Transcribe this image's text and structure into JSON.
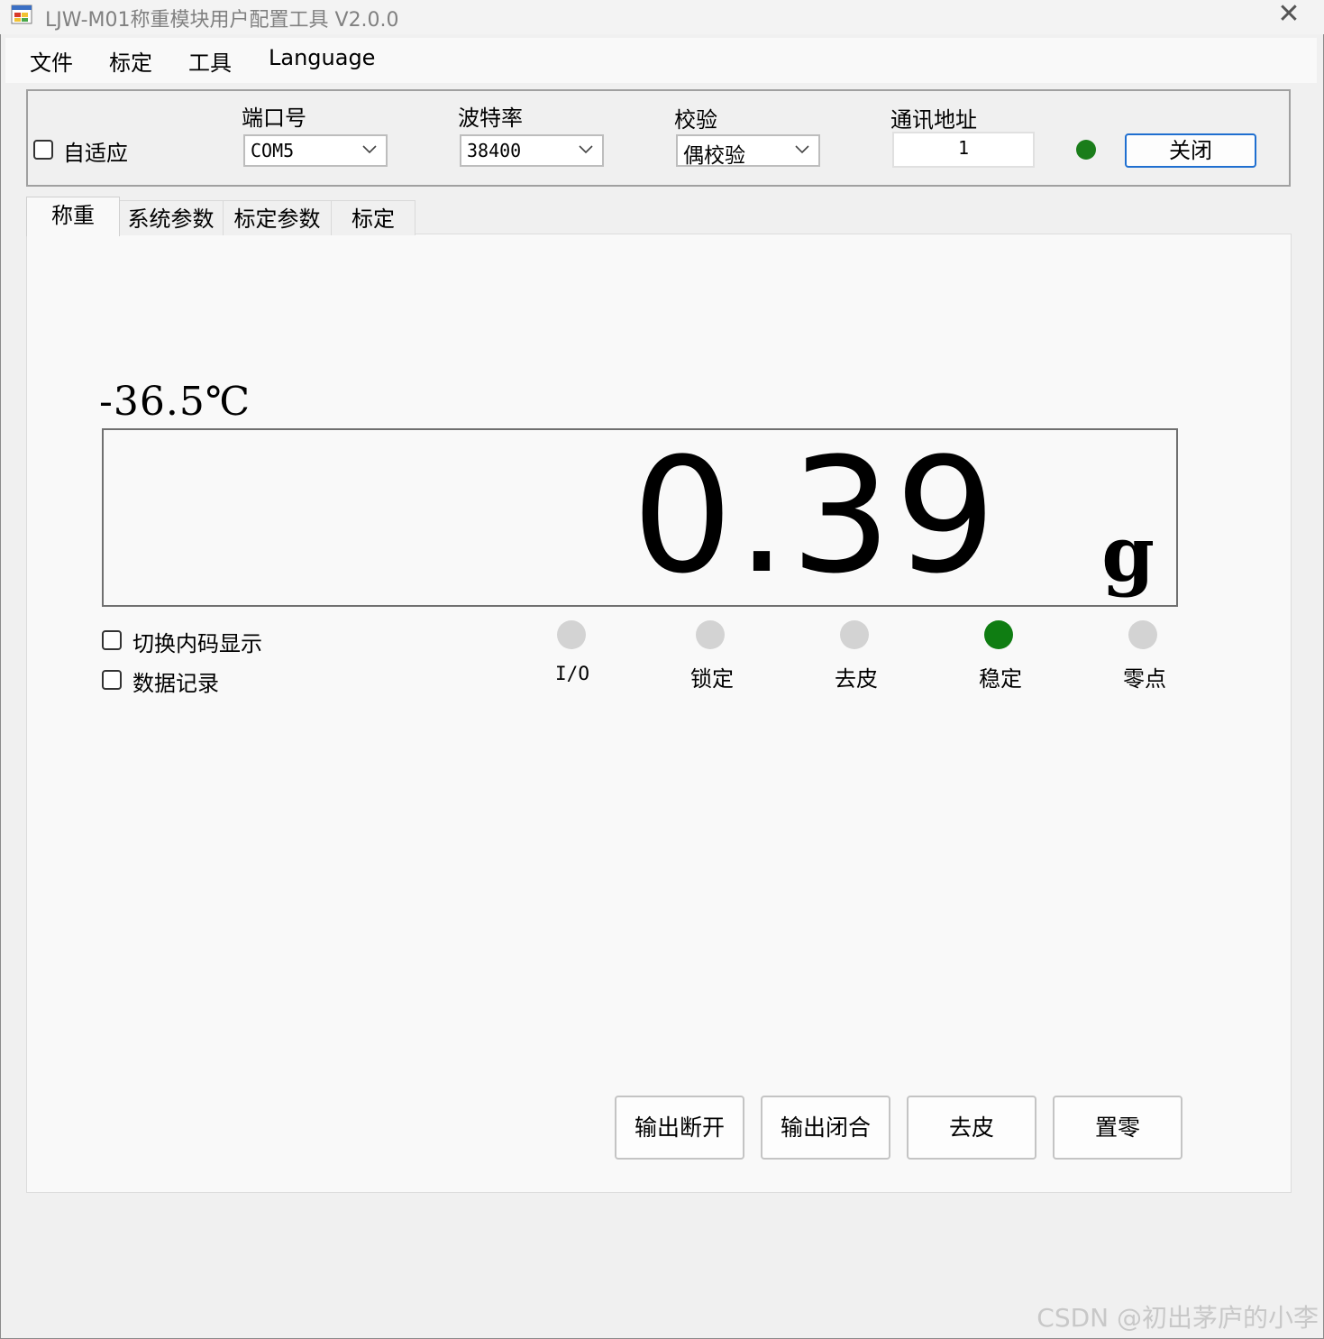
{
  "window": {
    "title": "LJW-M01称重模块用户配置工具 V2.0.0",
    "close_glyph": "✕"
  },
  "menu": {
    "items": [
      "文件",
      "标定",
      "工具",
      "Language"
    ]
  },
  "connection": {
    "auto_adapt_label": "自适应",
    "auto_adapt_checked": false,
    "port_label": "端口号",
    "port_value": "COM5",
    "baud_label": "波特率",
    "baud_value": "38400",
    "parity_label": "校验",
    "parity_value": "偶校验",
    "address_label": "通讯地址",
    "address_value": "1",
    "status_color": "#1a7d1a",
    "close_button": "关闭"
  },
  "tabs": [
    {
      "label": "称重",
      "active": true
    },
    {
      "label": "系统参数",
      "active": false
    },
    {
      "label": "标定参数",
      "active": false
    },
    {
      "label": "标定",
      "active": false
    }
  ],
  "weighing": {
    "temperature": "-36.5℃",
    "weight": "0.39",
    "unit": "g",
    "switch_internal_code_label": "切换内码显示",
    "data_record_label": "数据记录",
    "indicators": [
      {
        "label": "I/O",
        "on": false
      },
      {
        "label": "锁定",
        "on": false
      },
      {
        "label": "去皮",
        "on": false
      },
      {
        "label": "稳定",
        "on": true
      },
      {
        "label": "零点",
        "on": false
      }
    ],
    "indicator_on_color": "#0f7d12",
    "indicator_off_color": "#d3d3d3",
    "buttons": [
      "输出断开",
      "输出闭合",
      "去皮",
      "置零"
    ]
  },
  "watermark": "CSDN @初出茅庐的小李"
}
